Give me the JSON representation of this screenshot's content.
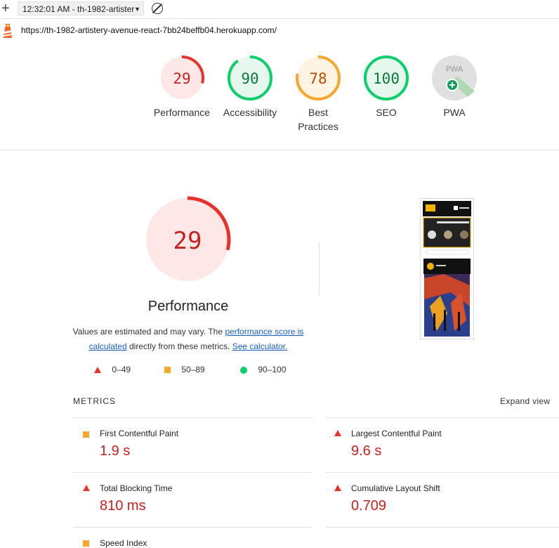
{
  "topbar": {
    "plus": "+",
    "selector": "12:32:01 AM - th-1982-artister",
    "arrow": "▼"
  },
  "url": "https://th-1982-artistery-avenue-react-7bb24beffb04.herokuapp.com/",
  "gauges": [
    {
      "score": "29",
      "label": "Performance",
      "fraction": 0.29,
      "color": "#e8332b",
      "bg": "#fde8e7",
      "text": "#c5221f"
    },
    {
      "score": "90",
      "label": "Accessibility",
      "fraction": 0.9,
      "color": "#0cce6b",
      "bg": "#e6f8ee",
      "text": "#0a7a3a"
    },
    {
      "score": "78",
      "label": "Best Practices",
      "fraction": 0.78,
      "color": "#f6a72e",
      "bg": "#fff3e3",
      "text": "#b44d00"
    },
    {
      "score": "100",
      "label": "SEO",
      "fraction": 1.0,
      "color": "#0cce6b",
      "bg": "#e6f8ee",
      "text": "#0a7a3a"
    },
    {
      "score": "PWA",
      "label": "PWA"
    }
  ],
  "performance": {
    "score": "29",
    "fraction": 0.29,
    "title": "Performance",
    "desc_start": "Values are estimated and may vary. The ",
    "link1": "performance score is calculated",
    "desc_mid": " directly from these metrics. ",
    "link2": "See calculator."
  },
  "legend": [
    {
      "shape": "triangle",
      "range": "0–49"
    },
    {
      "shape": "square",
      "range": "50–89"
    },
    {
      "shape": "circle",
      "range": "90–100"
    }
  ],
  "metrics_heading": "METRICS",
  "expand_view": "Expand view",
  "metrics": [
    {
      "name": "First Contentful Paint",
      "value": "1.9 s",
      "status": "square"
    },
    {
      "name": "Largest Contentful Paint",
      "value": "9.6 s",
      "status": "triangle"
    },
    {
      "name": "Total Blocking Time",
      "value": "810 ms",
      "status": "triangle"
    },
    {
      "name": "Cumulative Layout Shift",
      "value": "0.709",
      "status": "triangle"
    },
    {
      "name": "Speed Index",
      "value": "",
      "status": "square"
    }
  ]
}
